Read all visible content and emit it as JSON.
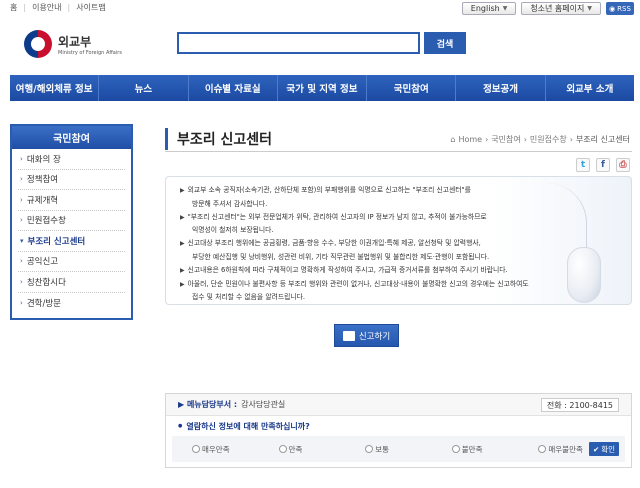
{
  "top_links": [
    "홈",
    "이용안내",
    "사이트맵"
  ],
  "top_right": {
    "lang": "English",
    "youth": "청소년 홈페이지",
    "rss": "RSS"
  },
  "logo": {
    "ko": "외교부",
    "en": "Ministry of Foreign Affairs"
  },
  "search": {
    "value": "",
    "button": "검색"
  },
  "nav": [
    "여행/해외체류 정보",
    "뉴스",
    "이슈별 자료실",
    "국가 및 지역 정보",
    "국민참여",
    "정보공개",
    "외교부 소개"
  ],
  "sidebar": {
    "title": "국민참여",
    "items": [
      {
        "label": "대화의 장"
      },
      {
        "label": "정책참여"
      },
      {
        "label": "규제개혁"
      },
      {
        "label": "민원접수창"
      },
      {
        "label": "부조리 신고센터"
      },
      {
        "label": "공익신고"
      },
      {
        "label": "칭찬합시다"
      },
      {
        "label": "견학/방문"
      }
    ]
  },
  "page": {
    "title": "부조리 신고센터",
    "breadcrumb": [
      "Home",
      "국민참여",
      "민원접수창",
      "부조리 신고센터"
    ]
  },
  "share": {
    "twitter": "t",
    "facebook": "f"
  },
  "notice_lines": [
    "외교부 소속 공직자(소속기관, 산하단체 포함)의 부패행위를 익명으로 신고하는 \"부조리 신고센터\"를",
    "방문해 주셔서 감사합니다.",
    "\"부조리 신고센터\"는 외부 전문업체가 위탁, 관리하여 신고자의 IP 정보가 남지 않고, 추적이 불가능하므로",
    "익명성이 철저히 보장됩니다.",
    "신고대상 부조리 행위에는 공금횡령, 금품·향응 수수, 부당한 이권개입·특혜 제공, 알선청탁 및 압력행사,",
    "부당한 예산집행 및 낭비행위, 성관련 비위, 기타 직무관련 불법행위 및 불합리한 제도·관행이 포함됩니다.",
    "신고내용은 6하원칙에 따라 구체적이고 명확하게 작성하여 주시고, 가급적 증거서류를 첨부하여 주시기 바랍니다.",
    "아울러, 단순 민원이나 불편사항 등 부조리 행위와 관련이 없거나, 신고대상·내용이 불명확한 신고의 경우에는 신고하여도",
    "접수 및 처리할 수 없음을 알려드립니다."
  ],
  "notice_bullets": [
    true,
    false,
    true,
    false,
    true,
    false,
    true,
    true,
    false
  ],
  "report_button": "신고하기",
  "feedback": {
    "dept_label": "메뉴담당부서 :",
    "dept_value": "감사담당관실",
    "phone": "전화 : 2100-8415",
    "question": "열람하신 정보에 대해 만족하십니까?",
    "options": [
      "매우만족",
      "만족",
      "보통",
      "불만족",
      "매우불만족"
    ],
    "confirm": "확인"
  }
}
